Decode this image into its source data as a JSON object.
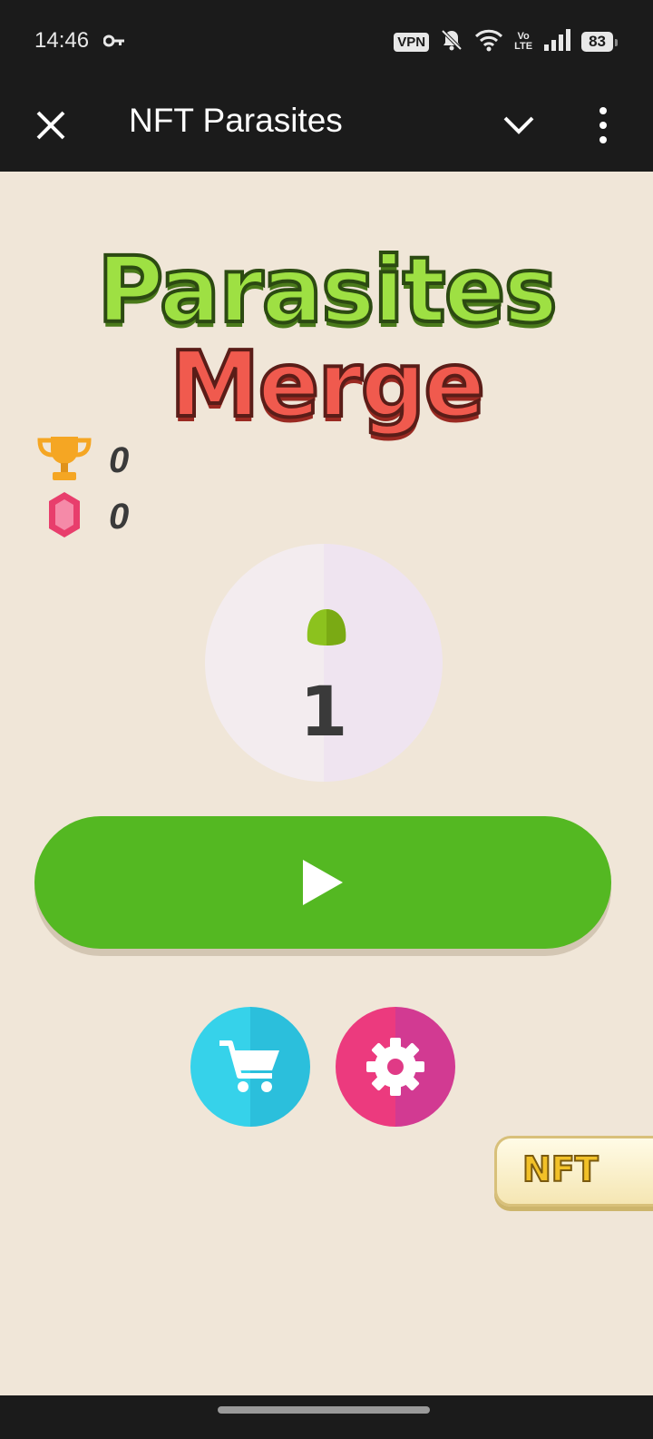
{
  "status_bar": {
    "time": "14:46",
    "vpn": "VPN",
    "volte_top": "Vo",
    "volte_bottom": "LTE",
    "battery": "83",
    "icons": [
      "key-icon",
      "mute-icon",
      "wifi-icon",
      "signal-icon",
      "battery-icon"
    ]
  },
  "app_bar": {
    "title": "NFT Parasites",
    "icons": [
      "close-icon",
      "chevron-down-icon",
      "more-vert-icon"
    ]
  },
  "game": {
    "logo_line1": "Parasites",
    "logo_line2": "Merge",
    "trophy_count": "0",
    "gem_count": "0",
    "level": "1",
    "nft_label": "NFT",
    "icons": [
      "trophy-icon",
      "gem-icon",
      "parasite-icon",
      "play-icon",
      "cart-icon",
      "gear-icon"
    ]
  },
  "colors": {
    "background": "#f0e6d8",
    "bar": "#1b1b1b",
    "play": "#54b822",
    "shop": "#36d2ea",
    "settings": "#ec3a7e"
  }
}
